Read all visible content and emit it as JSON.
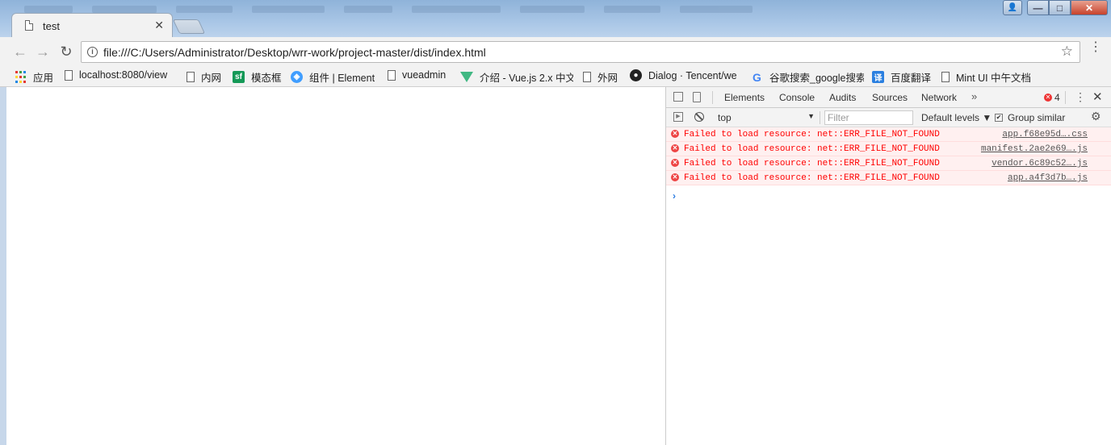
{
  "browser": {
    "tab": {
      "title": "test",
      "close": "✕"
    },
    "window_controls": {
      "user": "👤",
      "minimize": "—",
      "maximize": "□",
      "close": "✕"
    }
  },
  "toolbar": {
    "back": "←",
    "forward": "→",
    "reload": "↻",
    "url": "file:///C:/Users/Administrator/Desktop/wrr-work/project-master/dist/index.html",
    "star": "☆",
    "menu": "⋮"
  },
  "bookmarks": [
    {
      "label": "应用",
      "icon": "apps-icon"
    },
    {
      "label": "localhost:8080/view",
      "icon": "page-icon"
    },
    {
      "label": "内网",
      "icon": "page-icon"
    },
    {
      "label": "模态框",
      "icon": "sf-icon",
      "badge": "sf"
    },
    {
      "label": "组件 | Element",
      "icon": "element-icon",
      "badge": "◈"
    },
    {
      "label": "vueadmin",
      "icon": "page-icon"
    },
    {
      "label": "介绍 - Vue.js 2.x 中文",
      "icon": "vue-icon"
    },
    {
      "label": "外网",
      "icon": "page-icon"
    },
    {
      "label": "Dialog · Tencent/we",
      "icon": "github-icon",
      "badge": "●"
    },
    {
      "label": "谷歌搜索_google搜索",
      "icon": "google-icon",
      "badge": "G"
    },
    {
      "label": "百度翻译",
      "icon": "translate-icon",
      "badge": "译"
    },
    {
      "label": "Mint UI 中午文档",
      "icon": "page-icon"
    }
  ],
  "devtools": {
    "tabs": [
      "Elements",
      "Console",
      "Audits",
      "Sources",
      "Network"
    ],
    "more": "»",
    "error_count": "4",
    "close": "✕",
    "console_bar": {
      "context": "top",
      "filter_placeholder": "Filter",
      "levels": "Default levels ▼",
      "group_similar": "Group similar",
      "group_checked": "✔"
    },
    "messages": [
      {
        "text": "Failed to load resource: net::ERR_FILE_NOT_FOUND",
        "source": "app.f68e95d….css"
      },
      {
        "text": "Failed to load resource: net::ERR_FILE_NOT_FOUND",
        "source": "manifest.2ae2e69….js"
      },
      {
        "text": "Failed to load resource: net::ERR_FILE_NOT_FOUND",
        "source": "vendor.6c89c52….js"
      },
      {
        "text": "Failed to load resource: net::ERR_FILE_NOT_FOUND",
        "source": "app.a4f3d7b….js"
      }
    ],
    "prompt": "›"
  },
  "colors": {
    "error_red": "#ff0000",
    "error_bg": "#fff0f0",
    "prompt_blue": "#2a7be0"
  }
}
